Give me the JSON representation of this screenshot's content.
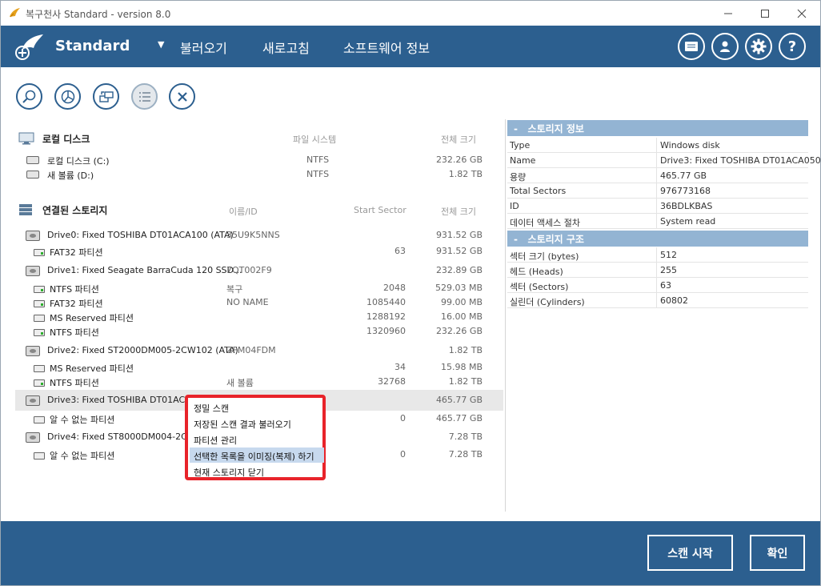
{
  "window": {
    "title": "복구천사 Standard - version 8.0",
    "controls": [
      "minimize-icon",
      "maximize-icon",
      "close-icon"
    ]
  },
  "header": {
    "brand": "Standard",
    "menu": [
      "불러오기",
      "새로고침",
      "소프트웨어 정보"
    ],
    "icon_buttons": [
      "id-card-icon",
      "user-icon",
      "gear-icon",
      "help-icon"
    ],
    "help_label": "?"
  },
  "toolbar": {
    "buttons": [
      "search-icon",
      "pie-chart-icon",
      "disk-image-icon",
      "list-icon",
      "close-icon"
    ]
  },
  "local": {
    "title": "로컬 디스크",
    "col_fs": "파일 시스템",
    "col_size": "전체 크기",
    "items": [
      {
        "name": "로컬 디스크 (C:)",
        "fs": "NTFS",
        "size": "232.26 GB"
      },
      {
        "name": "새 볼륨 (D:)",
        "fs": "NTFS",
        "size": "1.82 TB"
      }
    ]
  },
  "storage": {
    "title": "연결된 스토리지",
    "col_id": "이름/ID",
    "col_sector": "Start Sector",
    "col_size": "전체 크기",
    "rows": [
      {
        "kind": "drive",
        "name": "Drive0: Fixed TOSHIBA DT01ACA100 (ATA)",
        "id": "35U9K5NNS",
        "sector": "",
        "size": "931.52 GB"
      },
      {
        "kind": "part",
        "green": true,
        "name": "FAT32 파티션",
        "id": "",
        "sector": "63",
        "size": "931.52 GB"
      },
      {
        "kind": "drive",
        "name": "Drive1: Fixed Seagate BarraCuda 120 SSD...",
        "id": "7QT002F9",
        "sector": "",
        "size": "232.89 GB"
      },
      {
        "kind": "part",
        "green": true,
        "name": "NTFS 파티션",
        "id": "복구",
        "sector": "2048",
        "size": "529.03 MB"
      },
      {
        "kind": "part",
        "green": true,
        "name": "FAT32 파티션",
        "id": "NO NAME",
        "sector": "1085440",
        "size": "99.00 MB"
      },
      {
        "kind": "part",
        "green": false,
        "name": "MS Reserved 파티션",
        "id": "",
        "sector": "1288192",
        "size": "16.00 MB"
      },
      {
        "kind": "part",
        "green": true,
        "name": "NTFS 파티션",
        "id": "",
        "sector": "1320960",
        "size": "232.26 GB"
      },
      {
        "kind": "drive",
        "name": "Drive2: Fixed ST2000DM005-2CW102 (ATA)",
        "id": "ZFM04FDM",
        "sector": "",
        "size": "1.82 TB"
      },
      {
        "kind": "part",
        "green": false,
        "name": "MS Reserved 파티션",
        "id": "",
        "sector": "34",
        "size": "15.98 MB"
      },
      {
        "kind": "part",
        "green": true,
        "name": "NTFS 파티션",
        "id": "새 볼륨",
        "sector": "32768",
        "size": "1.82 TB"
      },
      {
        "kind": "drive",
        "selected": true,
        "name": "Drive3: Fixed TOSHIBA DT01ACA0",
        "id": "",
        "sector": "",
        "size": "465.77 GB"
      },
      {
        "kind": "part",
        "green": false,
        "name": "알 수 없는 파티션",
        "id": "",
        "sector": "0",
        "size": "465.77 GB"
      },
      {
        "kind": "drive",
        "name": "Drive4: Fixed ST8000DM004-2CX1",
        "id": "",
        "sector": "",
        "size": "7.28 TB"
      },
      {
        "kind": "part",
        "green": false,
        "name": "알 수 없는 파티션",
        "id": "",
        "sector": "0",
        "size": "7.28 TB"
      }
    ]
  },
  "info": {
    "title": "스토리지 정보",
    "collapse": "-",
    "rows": [
      {
        "k": "Type",
        "v": "Windows disk"
      },
      {
        "k": "Name",
        "v": "Drive3: Fixed TOSHIBA DT01ACA050"
      },
      {
        "k": "용량",
        "v": "465.77 GB"
      },
      {
        "k": "Total Sectors",
        "v": "976773168"
      },
      {
        "k": "ID",
        "v": "36BDLKBAS"
      },
      {
        "k": "데이터 액세스 절차",
        "v": "System read"
      }
    ]
  },
  "structure": {
    "title": "스토리지 구조",
    "collapse": "-",
    "rows": [
      {
        "k": "섹터 크기 (bytes)",
        "v": "512"
      },
      {
        "k": "헤드 (Heads)",
        "v": "255"
      },
      {
        "k": "섹터 (Sectors)",
        "v": "63"
      },
      {
        "k": "실린더 (Cylinders)",
        "v": "60802"
      }
    ]
  },
  "context_menu": {
    "items": [
      "정밀 스캔",
      "저장된 스캔 결과 불러오기",
      "파티션 관리",
      "선택한 목록을 이미징(복제) 하기",
      "현재 스토리지 닫기"
    ],
    "highlighted_index": 3,
    "border_color": "#e8232a"
  },
  "footer": {
    "scan_label": "스캔 시작",
    "ok_label": "확인"
  },
  "colors": {
    "accent": "#2c5f8f",
    "panel_header": "#93b4d3",
    "highlight": "#c7d9ee"
  }
}
